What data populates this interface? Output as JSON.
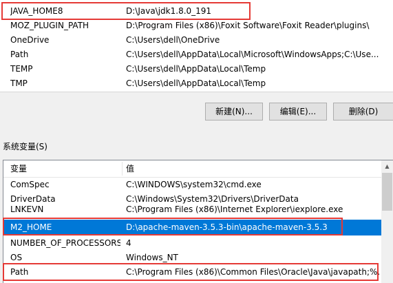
{
  "user_vars": [
    {
      "name": "JAVA_HOME8",
      "value": "D:\\Java\\jdk1.8.0_191"
    },
    {
      "name": "MOZ_PLUGIN_PATH",
      "value": "D:\\Program Files (x86)\\Foxit Software\\Foxit Reader\\plugins\\"
    },
    {
      "name": "OneDrive",
      "value": "C:\\Users\\dell\\OneDrive"
    },
    {
      "name": "Path",
      "value": "C:\\Users\\dell\\AppData\\Local\\Microsoft\\WindowsApps;C:\\Use..."
    },
    {
      "name": "TEMP",
      "value": "C:\\Users\\dell\\AppData\\Local\\Temp"
    },
    {
      "name": "TMP",
      "value": "C:\\Users\\dell\\AppData\\Local\\Temp"
    }
  ],
  "buttons": {
    "new": "新建(N)...",
    "edit": "编辑(E)...",
    "delete": "删除(D)"
  },
  "system_section_label": "系统变量(S)",
  "system_header": {
    "name": "变量",
    "value": "值"
  },
  "system_vars": [
    {
      "name": "ComSpec",
      "value": "C:\\WINDOWS\\system32\\cmd.exe"
    },
    {
      "name": "DriverData",
      "value": "C:\\Windows\\System32\\Drivers\\DriverData"
    },
    {
      "name": "LNKEVN",
      "value": "C:\\Program Files (x86)\\Internet Explorer\\iexplore.exe"
    },
    {
      "name": "M2_HOME",
      "value": "D:\\apache-maven-3.5.3-bin\\apache-maven-3.5.3",
      "selected": true
    },
    {
      "name": "NUMBER_OF_PROCESSORS",
      "value": "4"
    },
    {
      "name": "OS",
      "value": "Windows_NT"
    },
    {
      "name": "Path",
      "value": "C:\\Program Files (x86)\\Common Files\\Oracle\\Java\\javapath;%..."
    }
  ],
  "colors": {
    "selection": "#0078d7",
    "highlight_box": "#e53935"
  }
}
